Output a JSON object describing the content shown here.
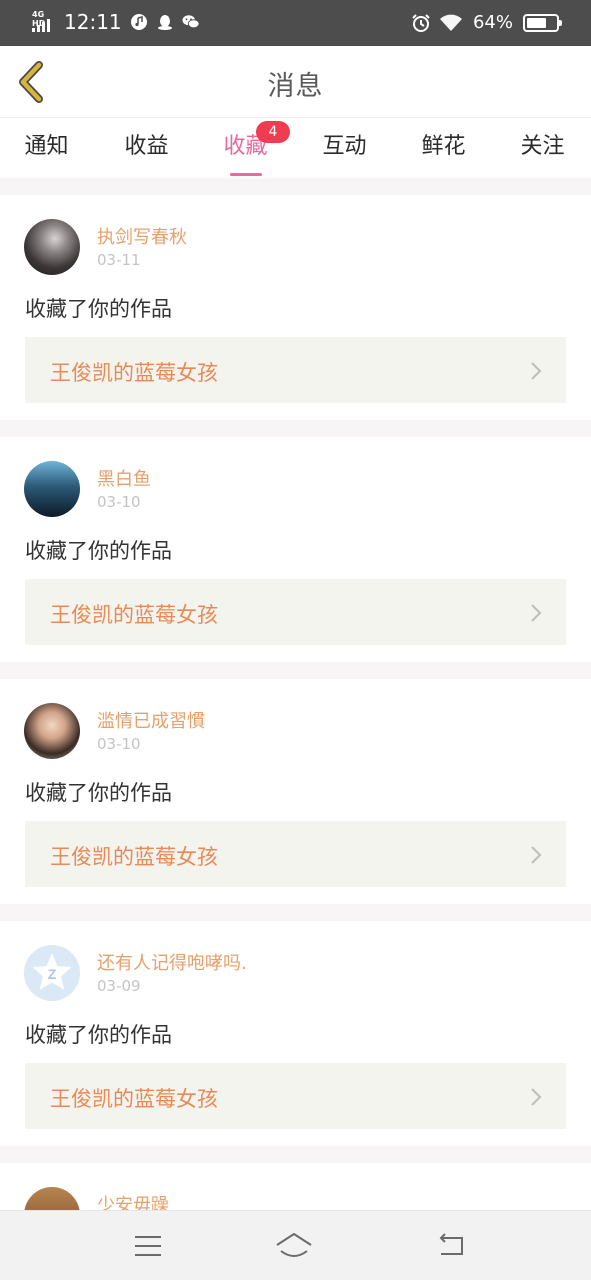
{
  "status_bar": {
    "network": "4G HD",
    "time": "12:11",
    "battery": "64%",
    "battery_level": 0.64,
    "icons": [
      "signal-icon",
      "music-icon",
      "qq-icon",
      "wechat-icon",
      "alarm-icon",
      "wifi-icon",
      "battery-icon"
    ]
  },
  "header": {
    "title": "消息",
    "back_icon": "chevron-left-icon"
  },
  "tabs": [
    {
      "label": "通知",
      "active": false
    },
    {
      "label": "收益",
      "active": false
    },
    {
      "label": "收藏",
      "active": true,
      "badge": "4"
    },
    {
      "label": "互动",
      "active": false
    },
    {
      "label": "鲜花",
      "active": false
    },
    {
      "label": "关注",
      "active": false
    }
  ],
  "messages": [
    {
      "user": "执剑写春秋",
      "date": "03-11",
      "action": "收藏了你的作品",
      "work": "王俊凯的蓝莓女孩"
    },
    {
      "user": "黑白鱼",
      "date": "03-10",
      "action": "收藏了你的作品",
      "work": "王俊凯的蓝莓女孩"
    },
    {
      "user": "滥情已成習慣",
      "date": "03-10",
      "action": "收藏了你的作品",
      "work": "王俊凯的蓝莓女孩"
    },
    {
      "user": "还有人记得咆哮吗.",
      "date": "03-09",
      "action": "收藏了你的作品",
      "work": "王俊凯的蓝莓女孩"
    },
    {
      "user": "少安毋躁"
    }
  ],
  "colors": {
    "accent": "#e9699e",
    "badge": "#f03c50",
    "username": "#e8a06a",
    "work_title": "#e88a58",
    "back_icon": "#d8b43a",
    "status_bar": "#4d4d4d"
  },
  "nav_bar": {
    "icons": [
      "menu-icon",
      "home-icon",
      "back-arrow-icon"
    ]
  }
}
